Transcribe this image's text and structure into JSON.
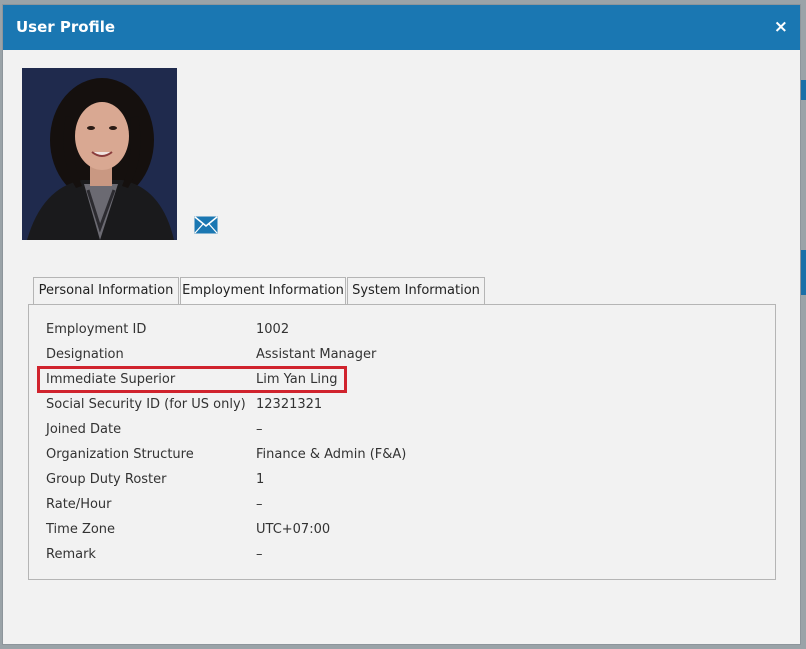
{
  "modal": {
    "title": "User Profile",
    "close_label": "×"
  },
  "tabs": [
    {
      "label": "Personal Information",
      "active": false
    },
    {
      "label": "Employment Information",
      "active": true
    },
    {
      "label": "System Information",
      "active": false
    }
  ],
  "fields": [
    {
      "label": "Employment ID",
      "value": "1002"
    },
    {
      "label": "Designation",
      "value": "Assistant Manager"
    },
    {
      "label": "Immediate Superior",
      "value": "Lim Yan Ling"
    },
    {
      "label": "Social Security ID (for US only)",
      "value": "12321321"
    },
    {
      "label": "Joined Date",
      "value": "–"
    },
    {
      "label": "Organization Structure",
      "value": "Finance & Admin (F&A)"
    },
    {
      "label": "Group Duty Roster",
      "value": "1"
    },
    {
      "label": "Rate/Hour",
      "value": "–"
    },
    {
      "label": "Time Zone",
      "value": "UTC+07:00"
    },
    {
      "label": "Remark",
      "value": "–"
    }
  ],
  "icons": {
    "email": "envelope-icon",
    "close": "close-icon"
  },
  "colors": {
    "header": "#1a77b2",
    "highlight": "#d0232d",
    "mail_icon": "#1a77b2"
  }
}
